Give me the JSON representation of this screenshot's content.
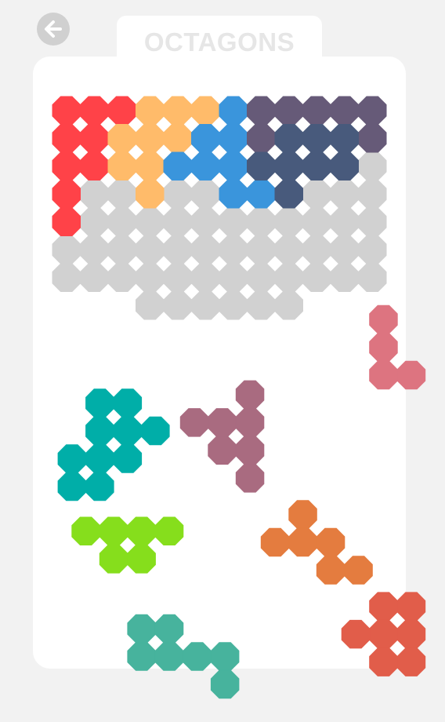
{
  "header": {
    "title": "OCTAGONS"
  },
  "icons": {
    "back": "arrow-left-icon"
  },
  "colors": {
    "background": "#f2f2f2",
    "board": "#ffffff",
    "back_button": "#d0d0d0",
    "title_text": "#e6e6e6",
    "empty_cell": "#d1d1d1"
  },
  "grid": {
    "cols": 12,
    "rows": 8,
    "empty_cells": [
      [
        2,
        0
      ],
      [
        3,
        0
      ],
      [
        5,
        0
      ],
      [
        6,
        0
      ],
      [
        7,
        0
      ],
      [
        8,
        0
      ],
      [
        9,
        0
      ],
      [
        10,
        0
      ],
      [
        11,
        0
      ],
      [
        0,
        1
      ],
      [
        1,
        1
      ],
      [
        2,
        1
      ],
      [
        3,
        1
      ],
      [
        4,
        1
      ],
      [
        5,
        1
      ],
      [
        6,
        1
      ],
      [
        7,
        1
      ],
      [
        8,
        1
      ],
      [
        9,
        1
      ],
      [
        10,
        1
      ],
      [
        11,
        1
      ],
      [
        0,
        2
      ],
      [
        1,
        2
      ],
      [
        2,
        2
      ],
      [
        3,
        2
      ],
      [
        4,
        2
      ],
      [
        5,
        2
      ],
      [
        6,
        2
      ],
      [
        7,
        2
      ],
      [
        8,
        2
      ],
      [
        9,
        2
      ],
      [
        10,
        2
      ],
      [
        11,
        2
      ],
      [
        0,
        3
      ],
      [
        1,
        3
      ],
      [
        2,
        3
      ],
      [
        3,
        3
      ],
      [
        4,
        3
      ],
      [
        5,
        3
      ],
      [
        6,
        3
      ],
      [
        7,
        3
      ],
      [
        8,
        3
      ],
      [
        9,
        3
      ],
      [
        10,
        3
      ],
      [
        11,
        3
      ],
      [
        0,
        4
      ],
      [
        1,
        4
      ],
      [
        2,
        4
      ],
      [
        3,
        4
      ],
      [
        4,
        4
      ],
      [
        5,
        4
      ],
      [
        6,
        4
      ],
      [
        7,
        4
      ],
      [
        8,
        4
      ],
      [
        9,
        4
      ],
      [
        10,
        4
      ],
      [
        11,
        4
      ],
      [
        0,
        5
      ],
      [
        1,
        5
      ],
      [
        2,
        5
      ],
      [
        3,
        5
      ],
      [
        4,
        5
      ],
      [
        5,
        5
      ],
      [
        6,
        5
      ],
      [
        7,
        5
      ],
      [
        8,
        5
      ],
      [
        9,
        5
      ],
      [
        10,
        5
      ],
      [
        11,
        5
      ],
      [
        0,
        6
      ],
      [
        1,
        6
      ],
      [
        2,
        6
      ],
      [
        3,
        6
      ],
      [
        4,
        6
      ],
      [
        5,
        6
      ],
      [
        6,
        6
      ],
      [
        7,
        6
      ],
      [
        8,
        6
      ],
      [
        9,
        6
      ],
      [
        10,
        6
      ],
      [
        11,
        6
      ],
      [
        3,
        7
      ],
      [
        4,
        7
      ],
      [
        5,
        7
      ],
      [
        6,
        7
      ],
      [
        7,
        7
      ],
      [
        8,
        7
      ]
    ]
  },
  "placed_pieces": [
    {
      "name": "red-piece",
      "color": "#ff4248",
      "cells": [
        [
          0,
          0
        ],
        [
          1,
          0
        ],
        [
          2,
          0
        ],
        [
          0,
          1
        ],
        [
          1,
          1
        ],
        [
          0,
          2
        ],
        [
          1,
          2
        ],
        [
          0,
          3
        ],
        [
          0,
          4
        ]
      ]
    },
    {
      "name": "orange-piece",
      "color": "#ffbb6a",
      "cells": [
        [
          3,
          0
        ],
        [
          4,
          0
        ],
        [
          5,
          0
        ],
        [
          2,
          1
        ],
        [
          3,
          1
        ],
        [
          4,
          1
        ],
        [
          2,
          2
        ],
        [
          3,
          2
        ],
        [
          3,
          3
        ]
      ]
    },
    {
      "name": "blue-piece",
      "color": "#3a95dc",
      "cells": [
        [
          6,
          0
        ],
        [
          5,
          1
        ],
        [
          6,
          1
        ],
        [
          4,
          2
        ],
        [
          5,
          2
        ],
        [
          6,
          2
        ],
        [
          6,
          3
        ],
        [
          7,
          3
        ]
      ]
    },
    {
      "name": "purple-piece",
      "color": "#665a78",
      "cells": [
        [
          7,
          0
        ],
        [
          8,
          0
        ],
        [
          9,
          0
        ],
        [
          10,
          0
        ],
        [
          11,
          0
        ],
        [
          7,
          1
        ],
        [
          11,
          1
        ]
      ]
    },
    {
      "name": "navy-piece",
      "color": "#485a7c",
      "cells": [
        [
          8,
          1
        ],
        [
          9,
          1
        ],
        [
          10,
          1
        ],
        [
          7,
          2
        ],
        [
          8,
          2
        ],
        [
          9,
          2
        ],
        [
          10,
          2
        ],
        [
          8,
          3
        ]
      ]
    }
  ],
  "tray_pieces": [
    {
      "name": "pink-piece",
      "color": "#dd7480",
      "cells": [
        [
          11.4,
          7.5
        ],
        [
          11.4,
          8.5
        ],
        [
          11.4,
          9.5
        ],
        [
          12.4,
          9.5
        ]
      ]
    },
    {
      "name": "teal-piece",
      "color": "#00aea8",
      "cells": [
        [
          1.2,
          10.5
        ],
        [
          2.2,
          10.5
        ],
        [
          1.2,
          11.5
        ],
        [
          2.2,
          11.5
        ],
        [
          3.2,
          11.5
        ],
        [
          0.2,
          12.5
        ],
        [
          1.2,
          12.5
        ],
        [
          2.2,
          12.5
        ],
        [
          0.2,
          13.5
        ],
        [
          1.2,
          13.5
        ]
      ]
    },
    {
      "name": "mauve-piece",
      "color": "#a96b80",
      "cells": [
        [
          6.6,
          10.2
        ],
        [
          4.6,
          11.2
        ],
        [
          5.6,
          11.2
        ],
        [
          6.6,
          11.2
        ],
        [
          5.6,
          12.2
        ],
        [
          6.6,
          12.2
        ],
        [
          6.6,
          13.2
        ]
      ]
    },
    {
      "name": "lime-piece",
      "color": "#86de1c",
      "cells": [
        [
          0.7,
          15.1
        ],
        [
          1.7,
          15.1
        ],
        [
          2.7,
          15.1
        ],
        [
          3.7,
          15.1
        ],
        [
          1.7,
          16.1
        ],
        [
          2.7,
          16.1
        ]
      ]
    },
    {
      "name": "dark-orange-piece",
      "color": "#e47c3f",
      "cells": [
        [
          8.5,
          14.5
        ],
        [
          7.5,
          15.5
        ],
        [
          8.5,
          15.5
        ],
        [
          9.5,
          15.5
        ],
        [
          9.5,
          16.5
        ],
        [
          10.5,
          16.5
        ]
      ]
    },
    {
      "name": "coral-piece",
      "color": "#e15d4a",
      "cells": [
        [
          11.4,
          17.8
        ],
        [
          12.4,
          17.8
        ],
        [
          10.4,
          18.8
        ],
        [
          11.4,
          18.8
        ],
        [
          12.4,
          18.8
        ],
        [
          11.4,
          19.8
        ],
        [
          12.4,
          19.8
        ]
      ]
    },
    {
      "name": "sea-green-piece",
      "color": "#47b39d",
      "cells": [
        [
          2.7,
          18.6
        ],
        [
          3.7,
          18.6
        ],
        [
          2.7,
          19.6
        ],
        [
          3.7,
          19.6
        ],
        [
          4.7,
          19.6
        ],
        [
          5.7,
          19.6
        ],
        [
          5.7,
          20.6
        ]
      ]
    }
  ]
}
